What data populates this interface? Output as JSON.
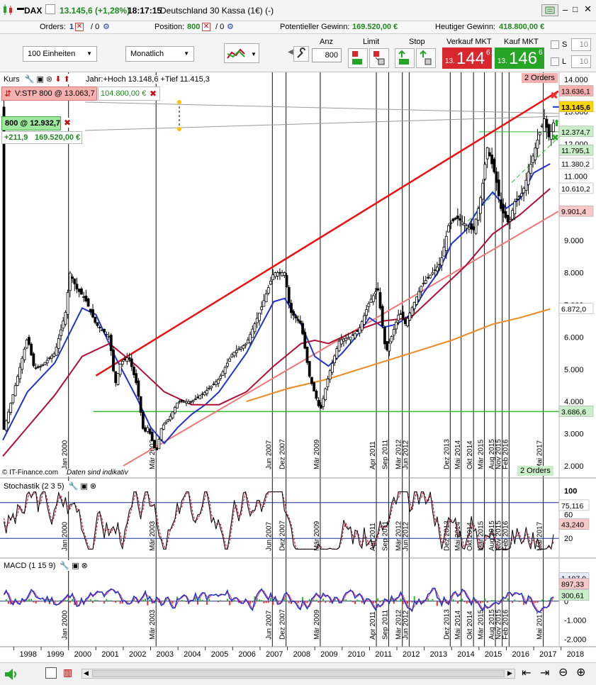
{
  "title_bar": {
    "symbol": "DAX",
    "last_price": "13.145,6 (+1,28%)",
    "time": "18:17:15",
    "instrument": "Deutschland 30 Kassa (1€) (-)"
  },
  "order_bar": {
    "orders_label": "Orders:",
    "orders_count": "1",
    "orders_sep": "/ 0",
    "position_label": "Position:",
    "position_value": "800",
    "position_sep": "/ 0",
    "potential_gain_label": "Potentieller Gewinn:",
    "potential_gain_value": "169.520,00 €",
    "today_gain_label": "Heutiger Gewinn:",
    "today_gain_value": "418.800,00 €"
  },
  "toolbar": {
    "units_select": "100 Einheiten",
    "period_select": "Monatlich",
    "anz_label": "Anz",
    "anz_value": "800",
    "limit_label": "Limit",
    "stop_label": "Stop",
    "sell_label": "Verkauf MKT",
    "sell_small": "13.",
    "sell_big": "144",
    "sell_sup": "6",
    "buy_label": "Kauf MKT",
    "buy_small": "13.",
    "buy_big": "146",
    "buy_sup": "6",
    "s_label": "S",
    "s_value": "10",
    "l_label": "L",
    "l_value": "10"
  },
  "colors": {
    "sell_bg": "#d9282d",
    "buy_bg": "#27a527",
    "sma_blue": "#2233cc",
    "sma_red": "#b01035",
    "sma_orange": "#f08a20",
    "trend_red": "#ee1111",
    "trend_pink": "#f07878",
    "support_green": "#33bb33"
  },
  "price_panel": {
    "header": "Kurs",
    "info": "Jahr:+Hoch 13.148,6 +Tief 11.415,3",
    "orders_top": "2 Orders",
    "orders_bottom": "2 Orders",
    "stop_order": "V:STP 800 @ 13.063,7",
    "stop_pnl": "104.800,00 €",
    "position": "800 @ 12.932,7",
    "position_pts": "+211,9",
    "position_pnl": "169.520,00 €",
    "copyright": "© IT-Finance.com",
    "disclaimer": "Daten sind indikativ"
  },
  "stoch_panel": {
    "header": "Stochastik (2 3 5)"
  },
  "macd_panel": {
    "header": "MACD (1 15 9)"
  },
  "chart_data": [
    {
      "type": "candlestick",
      "title": "DAX",
      "period": "Monatlich",
      "x_range": [
        1997.6,
        2018.1
      ],
      "ylim": [
        2000,
        14000
      ],
      "y_ticks": [
        "14.000",
        "13.000",
        "12.000",
        "11.000",
        "10.000",
        "9.000",
        "8.000",
        "7.000",
        "6.000",
        "5.000",
        "4.000",
        "3.000",
        "2.000"
      ],
      "price_labels": [
        {
          "text": "13.636,1",
          "value": 13636.1,
          "color": "#f6b0b0"
        },
        {
          "text": "13.145,6",
          "value": 13145.6,
          "color": "#ffd700"
        },
        {
          "text": "12.374,7",
          "value": 12374.7,
          "color": "#c9efc9"
        },
        {
          "text": "11.795,1",
          "value": 11795.1,
          "color": "#c9efc9"
        },
        {
          "text": "11.380,2",
          "value": 11380.2,
          "color": "#ffffff"
        },
        {
          "text": "10.610,2",
          "value": 10610.2,
          "color": "#ffffff"
        },
        {
          "text": "9.901,4",
          "value": 9901.4,
          "color": "#f6c8c8"
        },
        {
          "text": "6.872,0",
          "value": 6872.0,
          "color": "#ffffff"
        },
        {
          "text": "3.686,6",
          "value": 3686.6,
          "color": "#c9efc9"
        }
      ],
      "series": [
        {
          "name": "DAX",
          "style": "candles",
          "points": [
            [
              1997.6,
              3000
            ],
            [
              1998.0,
              4300
            ],
            [
              1998.5,
              6000
            ],
            [
              1998.75,
              5000
            ],
            [
              1999.0,
              5100
            ],
            [
              1999.5,
              5500
            ],
            [
              1999.9,
              6800
            ],
            [
              2000.05,
              8000
            ],
            [
              2000.3,
              7500
            ],
            [
              2000.6,
              7200
            ],
            [
              2001.0,
              6400
            ],
            [
              2001.5,
              6000
            ],
            [
              2001.7,
              4500
            ],
            [
              2001.9,
              5200
            ],
            [
              2002.2,
              5400
            ],
            [
              2002.5,
              4500
            ],
            [
              2002.75,
              3000
            ],
            [
              2002.9,
              3200
            ],
            [
              2003.2,
              2400
            ],
            [
              2003.4,
              3200
            ],
            [
              2003.7,
              3500
            ],
            [
              2004.0,
              4000
            ],
            [
              2004.5,
              4000
            ],
            [
              2005.0,
              4300
            ],
            [
              2005.5,
              4700
            ],
            [
              2006.0,
              5500
            ],
            [
              2006.5,
              5800
            ],
            [
              2007.0,
              6800
            ],
            [
              2007.5,
              8000
            ],
            [
              2007.9,
              8000
            ],
            [
              2008.1,
              6800
            ],
            [
              2008.5,
              6400
            ],
            [
              2008.8,
              4800
            ],
            [
              2009.2,
              3700
            ],
            [
              2009.5,
              4800
            ],
            [
              2009.9,
              5900
            ],
            [
              2010.3,
              6000
            ],
            [
              2010.6,
              6200
            ],
            [
              2011.0,
              7100
            ],
            [
              2011.3,
              7500
            ],
            [
              2011.6,
              5500
            ],
            [
              2011.8,
              6000
            ],
            [
              2012.1,
              6800
            ],
            [
              2012.3,
              6400
            ],
            [
              2012.6,
              7000
            ],
            [
              2012.9,
              7600
            ],
            [
              2013.3,
              8000
            ],
            [
              2013.6,
              8300
            ],
            [
              2013.9,
              9500
            ],
            [
              2014.2,
              9700
            ],
            [
              2014.5,
              9500
            ],
            [
              2014.8,
              9300
            ],
            [
              2015.1,
              10500
            ],
            [
              2015.3,
              11900
            ],
            [
              2015.6,
              11000
            ],
            [
              2015.8,
              10000
            ],
            [
              2016.1,
              9500
            ],
            [
              2016.3,
              10200
            ],
            [
              2016.6,
              10500
            ],
            [
              2016.9,
              11400
            ],
            [
              2017.2,
              12300
            ],
            [
              2017.4,
              12800
            ],
            [
              2017.55,
              12200
            ],
            [
              2017.7,
              12500
            ],
            [
              2017.8,
              13145.6
            ]
          ]
        },
        {
          "name": "",
          "style": "line",
          "color": "#2233cc",
          "points": [
            [
              1997.6,
              2800
            ],
            [
              1998.5,
              4300
            ],
            [
              1999.5,
              5200
            ],
            [
              2000.5,
              6900
            ],
            [
              2001.0,
              6700
            ],
            [
              2001.7,
              5400
            ],
            [
              2002.5,
              4100
            ],
            [
              2003.0,
              3200
            ],
            [
              2003.5,
              2700
            ],
            [
              2004.0,
              3200
            ],
            [
              2004.5,
              3600
            ],
            [
              2005.0,
              3900
            ],
            [
              2005.5,
              4300
            ],
            [
              2006.0,
              4900
            ],
            [
              2006.5,
              5500
            ],
            [
              2007.0,
              6300
            ],
            [
              2007.5,
              7100
            ],
            [
              2007.9,
              7200
            ],
            [
              2008.5,
              6400
            ],
            [
              2009.0,
              5400
            ],
            [
              2009.5,
              5100
            ],
            [
              2010.0,
              5500
            ],
            [
              2010.5,
              6000
            ],
            [
              2011.0,
              6600
            ],
            [
              2011.5,
              6300
            ],
            [
              2012.0,
              6400
            ],
            [
              2012.5,
              6700
            ],
            [
              2013.0,
              7400
            ],
            [
              2013.5,
              8000
            ],
            [
              2014.0,
              8900
            ],
            [
              2014.5,
              9300
            ],
            [
              2015.0,
              10000
            ],
            [
              2015.5,
              10500
            ],
            [
              2016.0,
              10000
            ],
            [
              2016.5,
              10300
            ],
            [
              2017.0,
              11100
            ],
            [
              2017.6,
              11380.2
            ]
          ]
        },
        {
          "name": "",
          "style": "line",
          "color": "#b01035",
          "points": [
            [
              1997.6,
              2300
            ],
            [
              1998.5,
              3200
            ],
            [
              1999.5,
              4200
            ],
            [
              2000.5,
              5400
            ],
            [
              2001.5,
              5800
            ],
            [
              2002.5,
              5100
            ],
            [
              2003.5,
              4300
            ],
            [
              2004.5,
              3900
            ],
            [
              2005.5,
              3900
            ],
            [
              2006.5,
              4300
            ],
            [
              2007.5,
              5100
            ],
            [
              2008.5,
              5800
            ],
            [
              2009.0,
              5900
            ],
            [
              2009.5,
              5800
            ],
            [
              2010.5,
              6200
            ],
            [
              2011.5,
              6500
            ],
            [
              2012.5,
              6600
            ],
            [
              2013.5,
              7400
            ],
            [
              2014.5,
              8200
            ],
            [
              2015.5,
              9200
            ],
            [
              2016.5,
              9800
            ],
            [
              2017.6,
              10610.2
            ]
          ]
        },
        {
          "name": "",
          "style": "line",
          "color": "#f08a20",
          "points": [
            [
              2006.5,
              4000
            ],
            [
              2008.0,
              4400
            ],
            [
              2009.5,
              4700
            ],
            [
              2011.0,
              5100
            ],
            [
              2012.5,
              5500
            ],
            [
              2014.0,
              5900
            ],
            [
              2015.5,
              6400
            ],
            [
              2016.5,
              6600
            ],
            [
              2017.6,
              6872.0
            ]
          ]
        }
      ],
      "lines": [
        {
          "name": "",
          "color": "#ee1111",
          "from": [
            2001.0,
            4800
          ],
          "to": [
            2017.9,
            13636.1
          ]
        },
        {
          "name": "",
          "color": "#f07878",
          "from": [
            2002.0,
            2000
          ],
          "to": [
            2017.9,
            9901.4
          ]
        },
        {
          "name": "",
          "color": "#33bb33",
          "y": 3686.6
        },
        {
          "name": "",
          "color": "#33bb33",
          "y": 12374.7,
          "from_x": 2015.0
        }
      ],
      "event_labels": [
        "Jan 2000",
        "Mär 2003",
        "Jun 2007",
        "Dez 2007",
        "Mär 2009",
        "Apr 2011",
        "Sep 2011",
        "Mär 2012",
        "Jun 2012",
        "Dez 2013",
        "Mai 2014",
        "Okt 2014",
        "Mär 2015",
        "Aug 2015",
        "Nov 2015",
        "Feb 2016",
        "Mai 2017"
      ],
      "x_ticks": [
        "1998",
        "1999",
        "2000",
        "2001",
        "2002",
        "2003",
        "2004",
        "2005",
        "2006",
        "2007",
        "2008",
        "2009",
        "2010",
        "2011",
        "2012",
        "2013",
        "2014",
        "2015",
        "2016",
        "2017",
        "2018"
      ]
    },
    {
      "type": "line",
      "title": "Stochastik (2 3 5)",
      "ylim": [
        0,
        100
      ],
      "y_ticks": [
        "100",
        "80",
        "60",
        "40",
        "20"
      ],
      "levels": [
        80,
        20
      ],
      "value_labels": [
        {
          "text": "75,116",
          "value": 75.116,
          "color": "#ffffff"
        },
        {
          "text": "43,240",
          "value": 43.24,
          "color": "#f6c8c8"
        }
      ]
    },
    {
      "type": "bar",
      "title": "MACD (1 15 9)",
      "ylim": [
        -2200,
        1700
      ],
      "y_ticks": [
        "1.000",
        "0",
        "-1.000",
        "-2.000"
      ],
      "value_labels": [
        {
          "text": "1.197,9",
          "value": 1197.9,
          "color": "#e8ecff"
        },
        {
          "text": "897,33",
          "value": 897.33,
          "color": "#f6c8c8"
        },
        {
          "text": "300,61",
          "value": 300.61,
          "color": "#c9efc9"
        }
      ]
    }
  ]
}
